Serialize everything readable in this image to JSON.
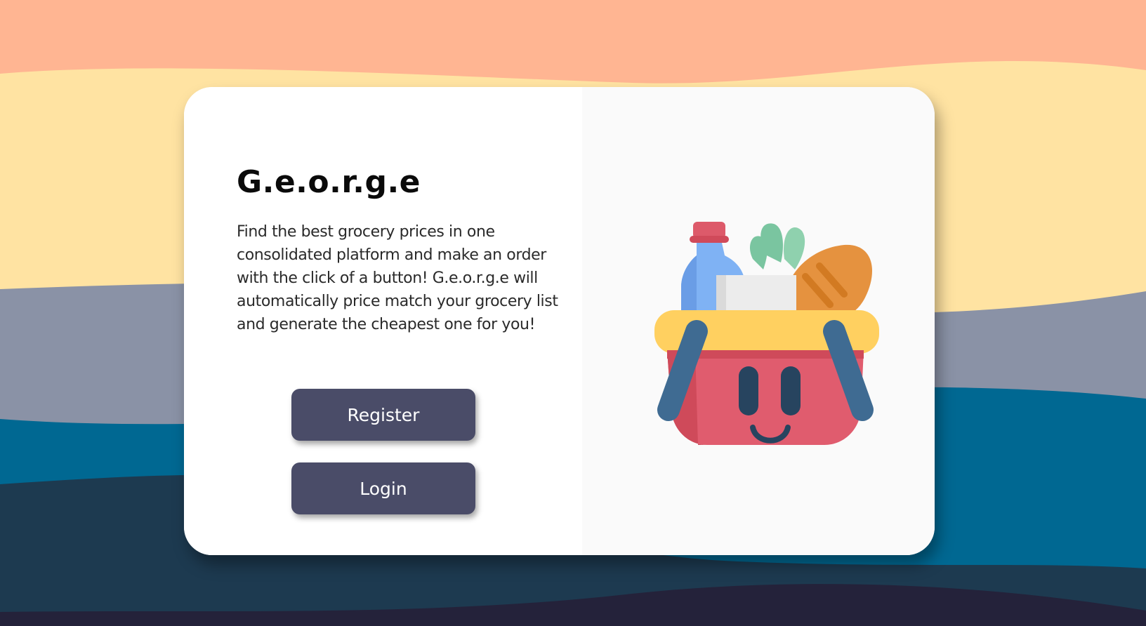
{
  "app": {
    "title": "G.e.o.r.g.e",
    "description": "Find the best grocery prices in one consolidated platform and make an order with the click of a button! G.e.o.r.g.e will automatically price match your grocery list and generate the cheapest one for you!"
  },
  "actions": {
    "register_label": "Register",
    "login_label": "Login"
  },
  "illustration": {
    "icon": "grocery-basket-icon"
  },
  "colors": {
    "button": "#4a4c68",
    "wave_peach": "#ffb592",
    "wave_yellow": "#ffe3a2",
    "wave_gray": "#8a92a6",
    "wave_blue": "#006892",
    "wave_navy": "#1d3a50",
    "wave_dark": "#24223a"
  }
}
